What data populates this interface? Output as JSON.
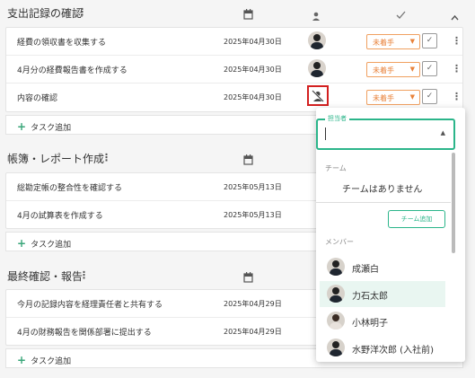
{
  "header_icons": {
    "calendar": "calendar-icon",
    "assignee": "person-icon",
    "done": "check-icon",
    "collapse": "chevron-up-icon"
  },
  "sections": [
    {
      "title": "支出記録の確認",
      "tasks": [
        {
          "title": "経費の領収書を収集する",
          "date": "2025年04月30日",
          "status": "未着手"
        },
        {
          "title": "4月分の経費報告書を作成する",
          "date": "2025年04月30日",
          "status": "未着手"
        },
        {
          "title": "内容の確認",
          "date": "2025年04月30日",
          "status": "未着手"
        }
      ],
      "add_label": "タスク追加"
    },
    {
      "title": "帳簿・レポート作成",
      "tasks": [
        {
          "title": "総勘定帳の整合性を確認する",
          "date": "2025年05月13日"
        },
        {
          "title": "4月の試算表を作成する",
          "date": "2025年05月13日"
        }
      ],
      "add_label": "タスク追加"
    },
    {
      "title": "最終確認・報告",
      "tasks": [
        {
          "title": "今月の記録内容を経理責任者と共有する",
          "date": "2025年04月29日"
        },
        {
          "title": "4月の財務報告を関係部署に提出する",
          "date": "2025年04月29日"
        }
      ],
      "add_label": "タスク追加"
    }
  ],
  "dropdown": {
    "field_label": "担当者",
    "team_section": "チーム",
    "team_empty": "チームはありません",
    "team_add": "チーム追加",
    "member_section": "メンバー",
    "members": [
      "成瀬白",
      "力石太郎",
      "小林明子",
      "水野洋次郎 (入社前)"
    ],
    "selected_member_index": 1
  },
  "colors": {
    "accent": "#2bb58a",
    "status": "#e8823a",
    "highlight": "#d32020"
  }
}
